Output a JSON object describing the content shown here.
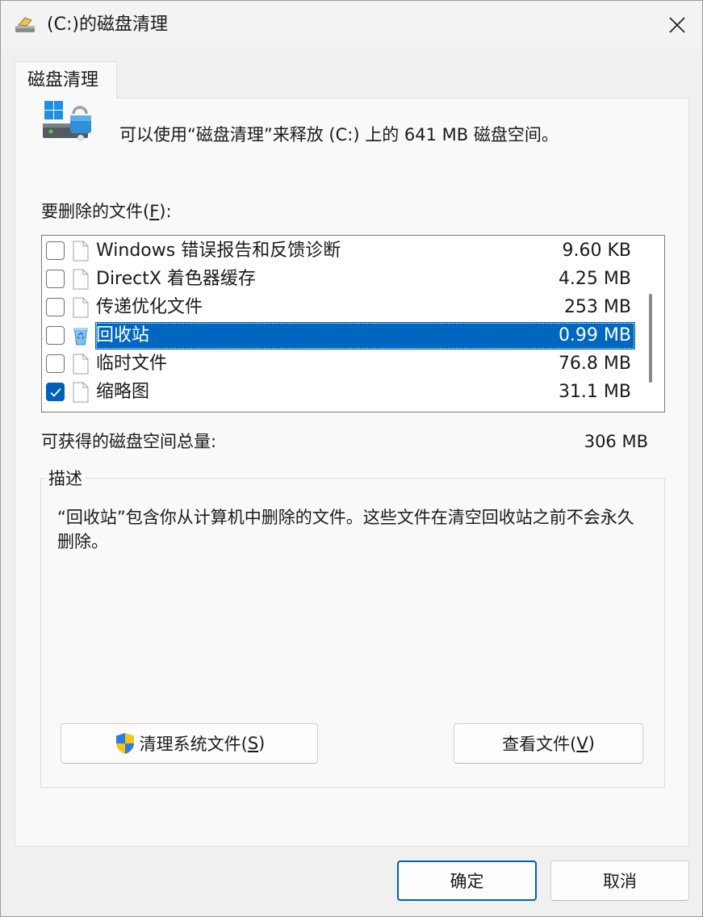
{
  "window": {
    "title": "(C:)的磁盘清理"
  },
  "tab": {
    "label": "磁盘清理"
  },
  "intro": {
    "text": "可以使用“磁盘清理”来释放 (C:) 上的 641 MB 磁盘空间。"
  },
  "files_label": {
    "before": "要删除的文件(",
    "accesskey": "F",
    "after": "):"
  },
  "files": [
    {
      "name": "Windows 错误报告和反馈诊断",
      "size": "9.60 KB",
      "checked": false,
      "icon": "file-icon"
    },
    {
      "name": "DirectX 着色器缓存",
      "size": "4.25 MB",
      "checked": false,
      "icon": "file-icon"
    },
    {
      "name": "传递优化文件",
      "size": "253 MB",
      "checked": false,
      "icon": "file-icon"
    },
    {
      "name": "回收站",
      "size": "0.99 MB",
      "checked": false,
      "icon": "recycle-bin-icon",
      "selected": true
    },
    {
      "name": "临时文件",
      "size": "76.8 MB",
      "checked": false,
      "icon": "file-icon"
    },
    {
      "name": "缩略图",
      "size": "31.1 MB",
      "checked": true,
      "icon": "file-icon"
    }
  ],
  "total": {
    "label": "可获得的磁盘空间总量:",
    "value": "306 MB"
  },
  "description": {
    "legend": "描述",
    "text": "“回收站”包含你从计算机中删除的文件。这些文件在清空回收站之前不会永久删除。"
  },
  "buttons": {
    "clean_system": {
      "before": "清理系统文件(",
      "accesskey": "S",
      "after": ")"
    },
    "view_files": {
      "before": "查看文件(",
      "accesskey": "V",
      "after": ")"
    },
    "ok": "确定",
    "cancel": "取消"
  },
  "colors": {
    "accent": "#005fb8",
    "selection": "#0067c0"
  }
}
